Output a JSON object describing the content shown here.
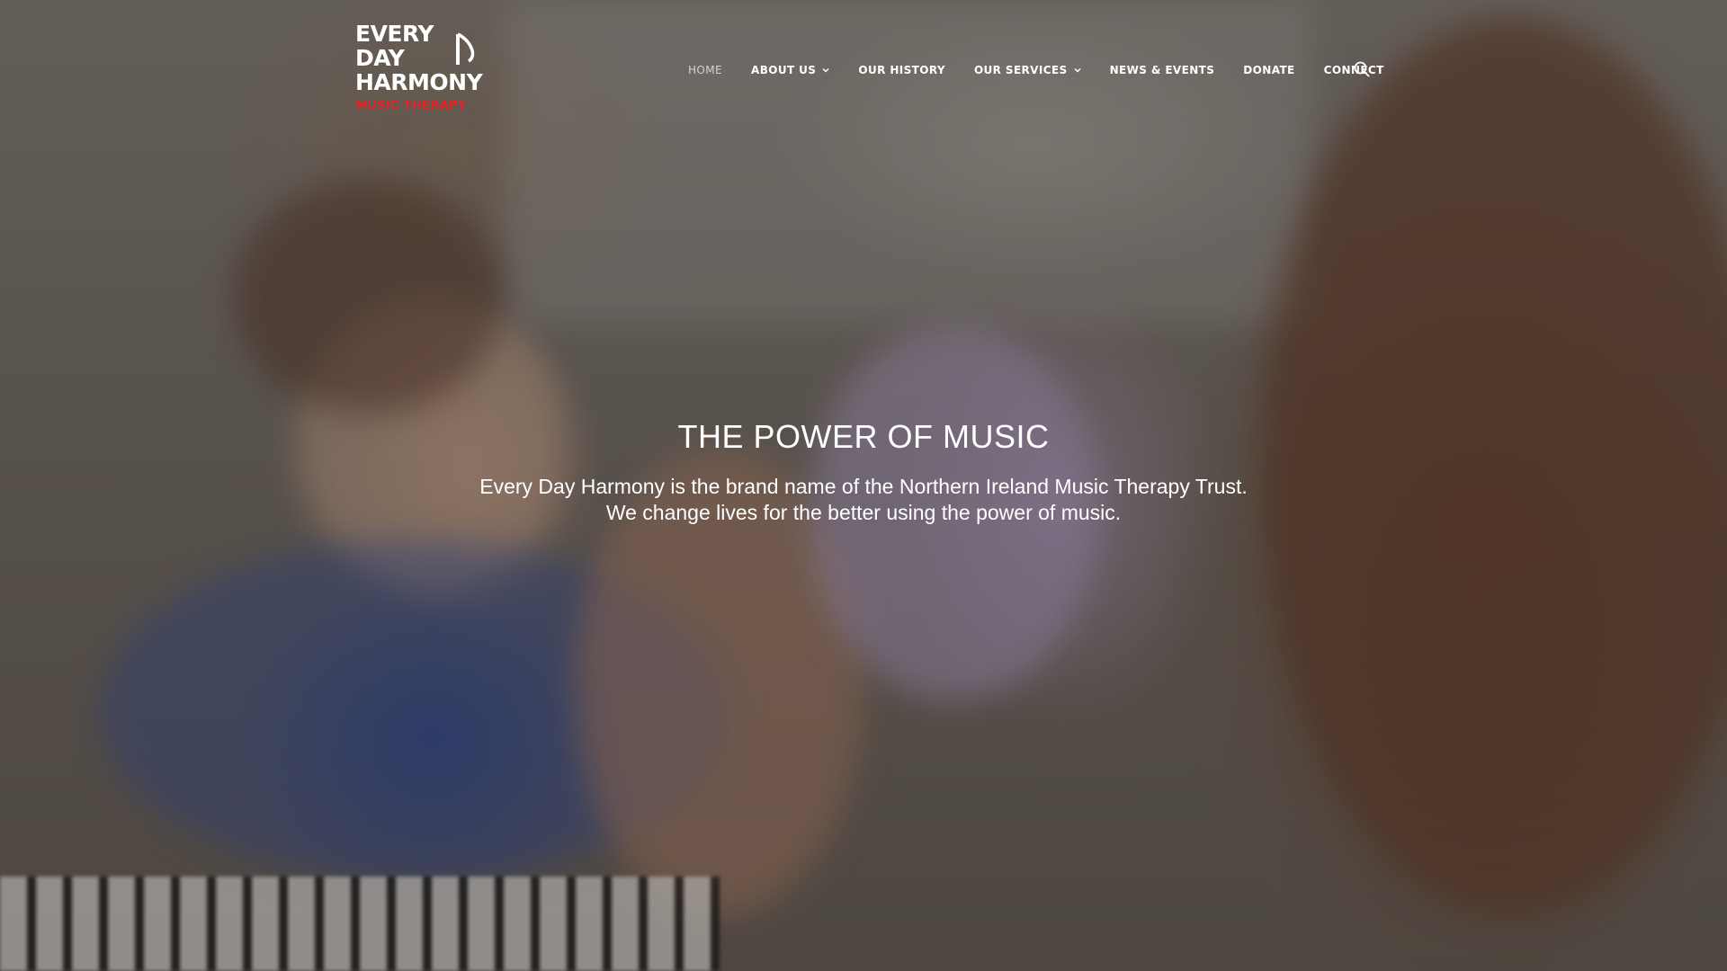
{
  "logo": {
    "lines": [
      "EVERY",
      "DAY",
      "HARMONY"
    ],
    "subtitle": "MUSIC THERAPY",
    "subtitle_color": "#e0262b"
  },
  "nav": {
    "items": [
      {
        "label": "HOME",
        "active": true,
        "has_dropdown": false
      },
      {
        "label": "ABOUT US",
        "active": false,
        "has_dropdown": true
      },
      {
        "label": "OUR HISTORY",
        "active": false,
        "has_dropdown": false
      },
      {
        "label": "OUR SERVICES",
        "active": false,
        "has_dropdown": true
      },
      {
        "label": "NEWS & EVENTS",
        "active": false,
        "has_dropdown": false
      },
      {
        "label": "DONATE",
        "active": false,
        "has_dropdown": false
      },
      {
        "label": "CONNECT",
        "active": false,
        "has_dropdown": false
      }
    ],
    "search_icon": "search-icon"
  },
  "hero": {
    "title": "THE POWER OF MUSIC",
    "description_line1": "Every Day Harmony is the brand name of the Northern Ireland Music Therapy Trust.",
    "description_line2": "We change lives for the better using the power of music."
  }
}
